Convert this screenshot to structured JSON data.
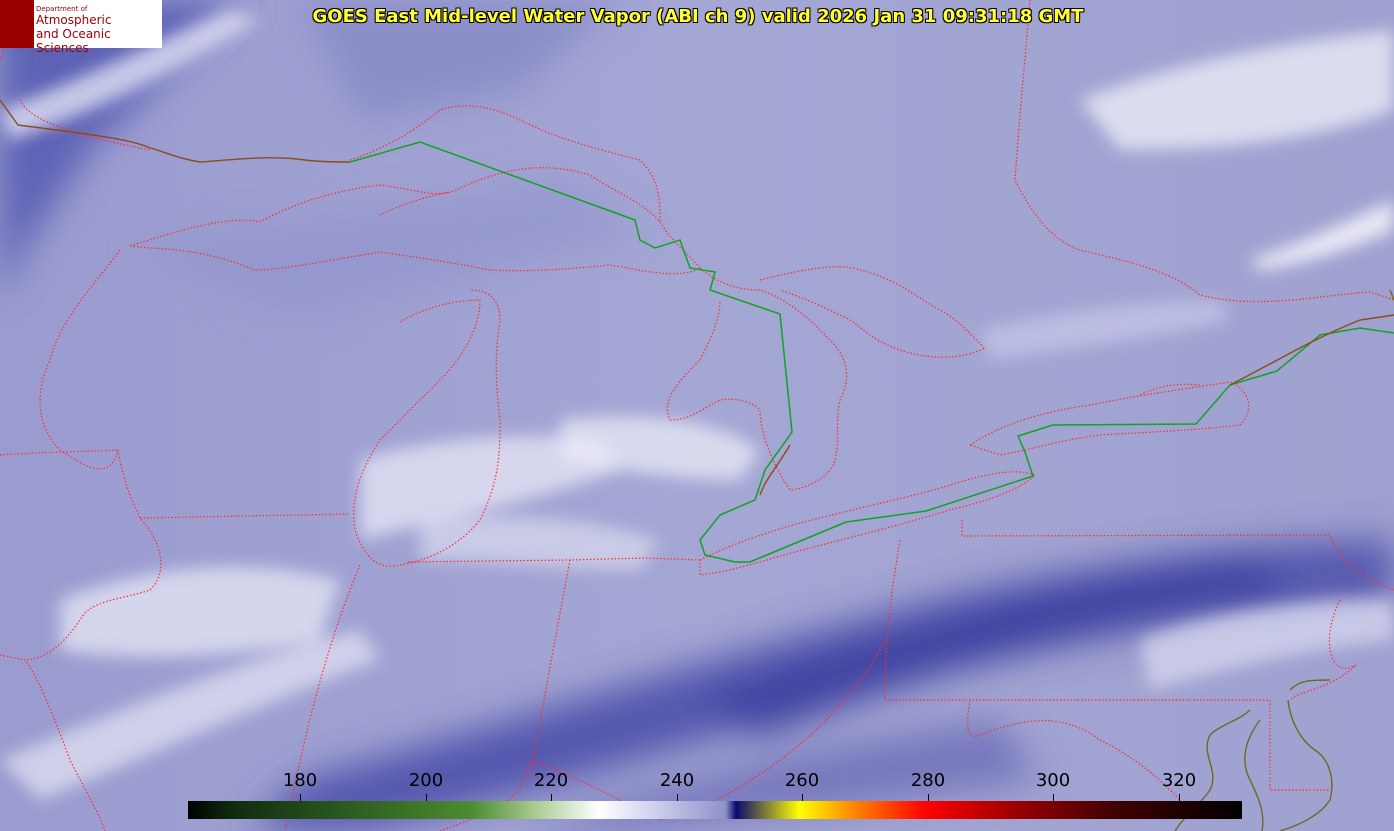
{
  "header": {
    "title": "GOES East Mid-level Water Vapor (ABI ch 9)  valid 2026 Jan 31 09:31:18 GMT"
  },
  "logo": {
    "department": "Department of",
    "line1": "Atmospheric",
    "line2": "and Oceanic Sciences"
  },
  "colorbar": {
    "labels": [
      {
        "text": "180"
      },
      {
        "text": "200"
      },
      {
        "text": "220"
      },
      {
        "text": "240"
      },
      {
        "text": "260"
      },
      {
        "text": "280"
      },
      {
        "text": "300"
      },
      {
        "text": "320"
      }
    ]
  },
  "colors": {
    "title_text": "#ffff33",
    "boundary_state": "#ff2b2b",
    "boundary_international": "#11a322",
    "coastline": "#8b4c1a",
    "dry_band": "#3b3e9e",
    "moist_cloud": "#e8e9f6"
  }
}
